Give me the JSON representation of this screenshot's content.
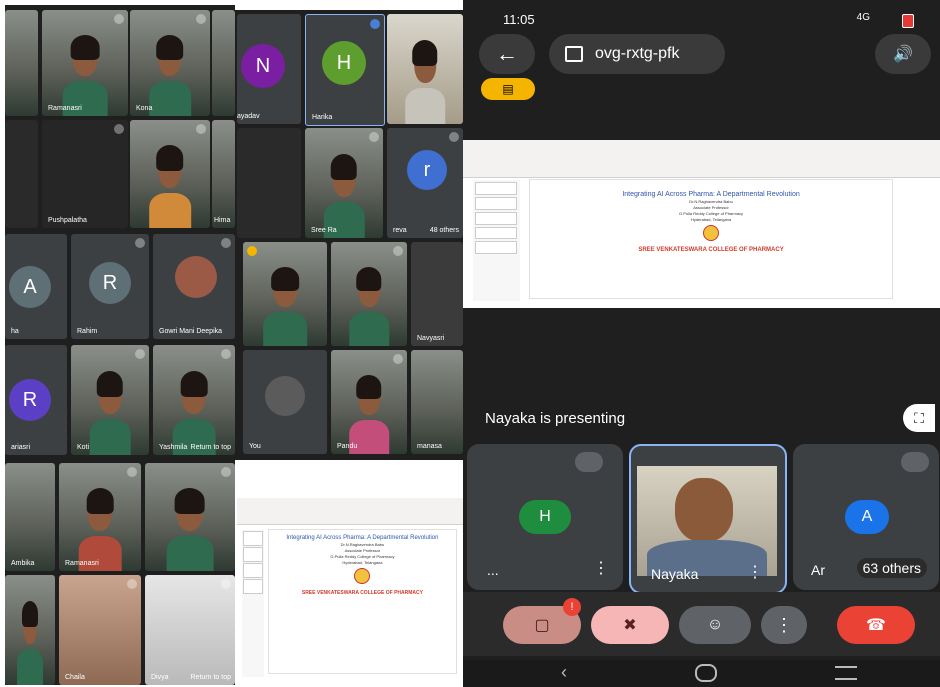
{
  "left_grid": {
    "names": {
      "tile_ramanasri_top": "Ramanasri",
      "tile_kona": "Kona",
      "tile_pushpalatha": "Pushpalatha",
      "tile_hima": "Hima",
      "tile_rahim_avatar": "R",
      "tile_rahim": "Rahim",
      "tile_gowri": "Gowri Mani Deepika",
      "tile_a": "A",
      "tile_ha": "ha",
      "tile_r2": "R",
      "tile_ariasri": "ariasri",
      "tile_kotti": "Koti",
      "tile_yashmila": "Yashmila",
      "return_to_top_1": "Return to top",
      "tile_ambika": "Ambika",
      "tile_ramanasri": "Ramanasri",
      "tile_chaila": "Chaila",
      "tile_divya": "Divya",
      "return_to_top_2": "Return to top"
    }
  },
  "mid_grid": {
    "tile_n_letter": "N",
    "tile_n_name": "ayadav",
    "tile_h_letter": "H",
    "tile_harika": "Harika",
    "tile_sree": "Sree Ra",
    "tile_r_letter": "r",
    "tile_reva": "reva",
    "tile_48_others": "48 others",
    "tile_navyasri": "Navyasri",
    "tile_you": "You",
    "tile_pandu": "Pandu",
    "tile_manasa": "manasa"
  },
  "slide": {
    "title": "Integrating AI Across Pharma: A Departmental Revolution",
    "lines": [
      "Dr.N.Raghavendra Babu",
      "Associate Professor",
      "G.Pulla Reddy College of Pharmacy",
      "Hyderabad, Telangana"
    ],
    "presentation_by": "Presentation at",
    "brand": "SREE VENKATESWARA COLLEGE OF PHARMACY"
  },
  "phone": {
    "status_time": "11:05",
    "status_right": "4G",
    "meeting_code": "ovg-rxtg-pfk",
    "presenting_text": "Nayaka is presenting",
    "participants": {
      "h_letter": "H",
      "h_name": "...",
      "center_name": "Nayaka",
      "a_letter": "A",
      "a_name": "Ar",
      "others": "63 others"
    },
    "colors": {
      "avatar_green": "#1e8e3e",
      "avatar_blue": "#1a73e8",
      "end_call": "#ea4335",
      "mic_off_bg": "#f6b6b6",
      "cam_off_bg": "#c98d86",
      "badge_yellow": "#f4b400"
    }
  }
}
